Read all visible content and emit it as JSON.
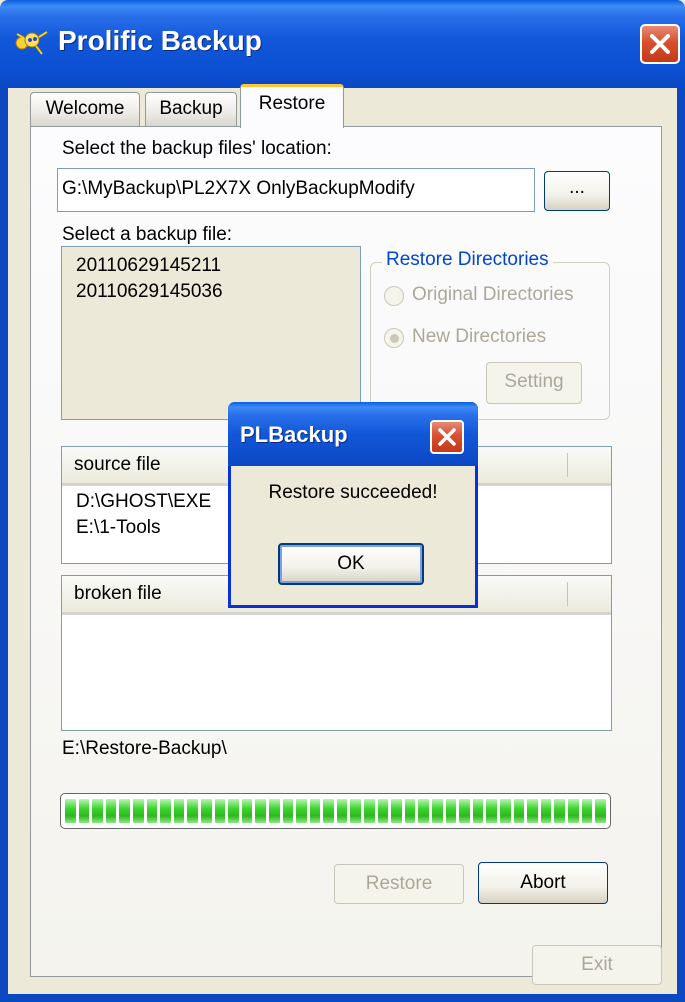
{
  "window": {
    "title": "Prolific Backup",
    "icon": "prolific-app-icon",
    "close_icon": "close-icon"
  },
  "tabs": [
    {
      "label": "Welcome",
      "selected": false
    },
    {
      "label": "Backup",
      "selected": false
    },
    {
      "label": "Restore",
      "selected": true
    }
  ],
  "restore": {
    "location_label": "Select the backup files' location:",
    "location_value": "G:\\MyBackup\\PL2X7X OnlyBackupModify",
    "browse_label": "...",
    "backup_file_label": "Select a backup file:",
    "backup_files": [
      "20110629145211",
      "20110629145036"
    ],
    "restore_dirs": {
      "label": "Restore Directories",
      "original_label": "Original Directories",
      "new_label": "New Directories",
      "selected": "New Directories",
      "setting_label": "Setting"
    },
    "source_list": {
      "header": "source file",
      "rows": [
        "D:\\GHOST\\EXE",
        "E:\\1-Tools"
      ]
    },
    "broken_list": {
      "header": "broken file",
      "rows": []
    },
    "destination_path": "E:\\Restore-Backup\\",
    "progress_fraction": 1.0,
    "restore_button": "Restore",
    "abort_button": "Abort"
  },
  "exit_button": "Exit",
  "dialog": {
    "title": "PLBackup",
    "message": "Restore succeeded!",
    "ok_label": "OK",
    "close_icon": "close-icon"
  },
  "colors": {
    "titlebar_blue": "#0b48c2",
    "group_label_blue": "#0046d5",
    "progress_green": "#3ed430",
    "active_tab_accent": "#ffc83c"
  }
}
